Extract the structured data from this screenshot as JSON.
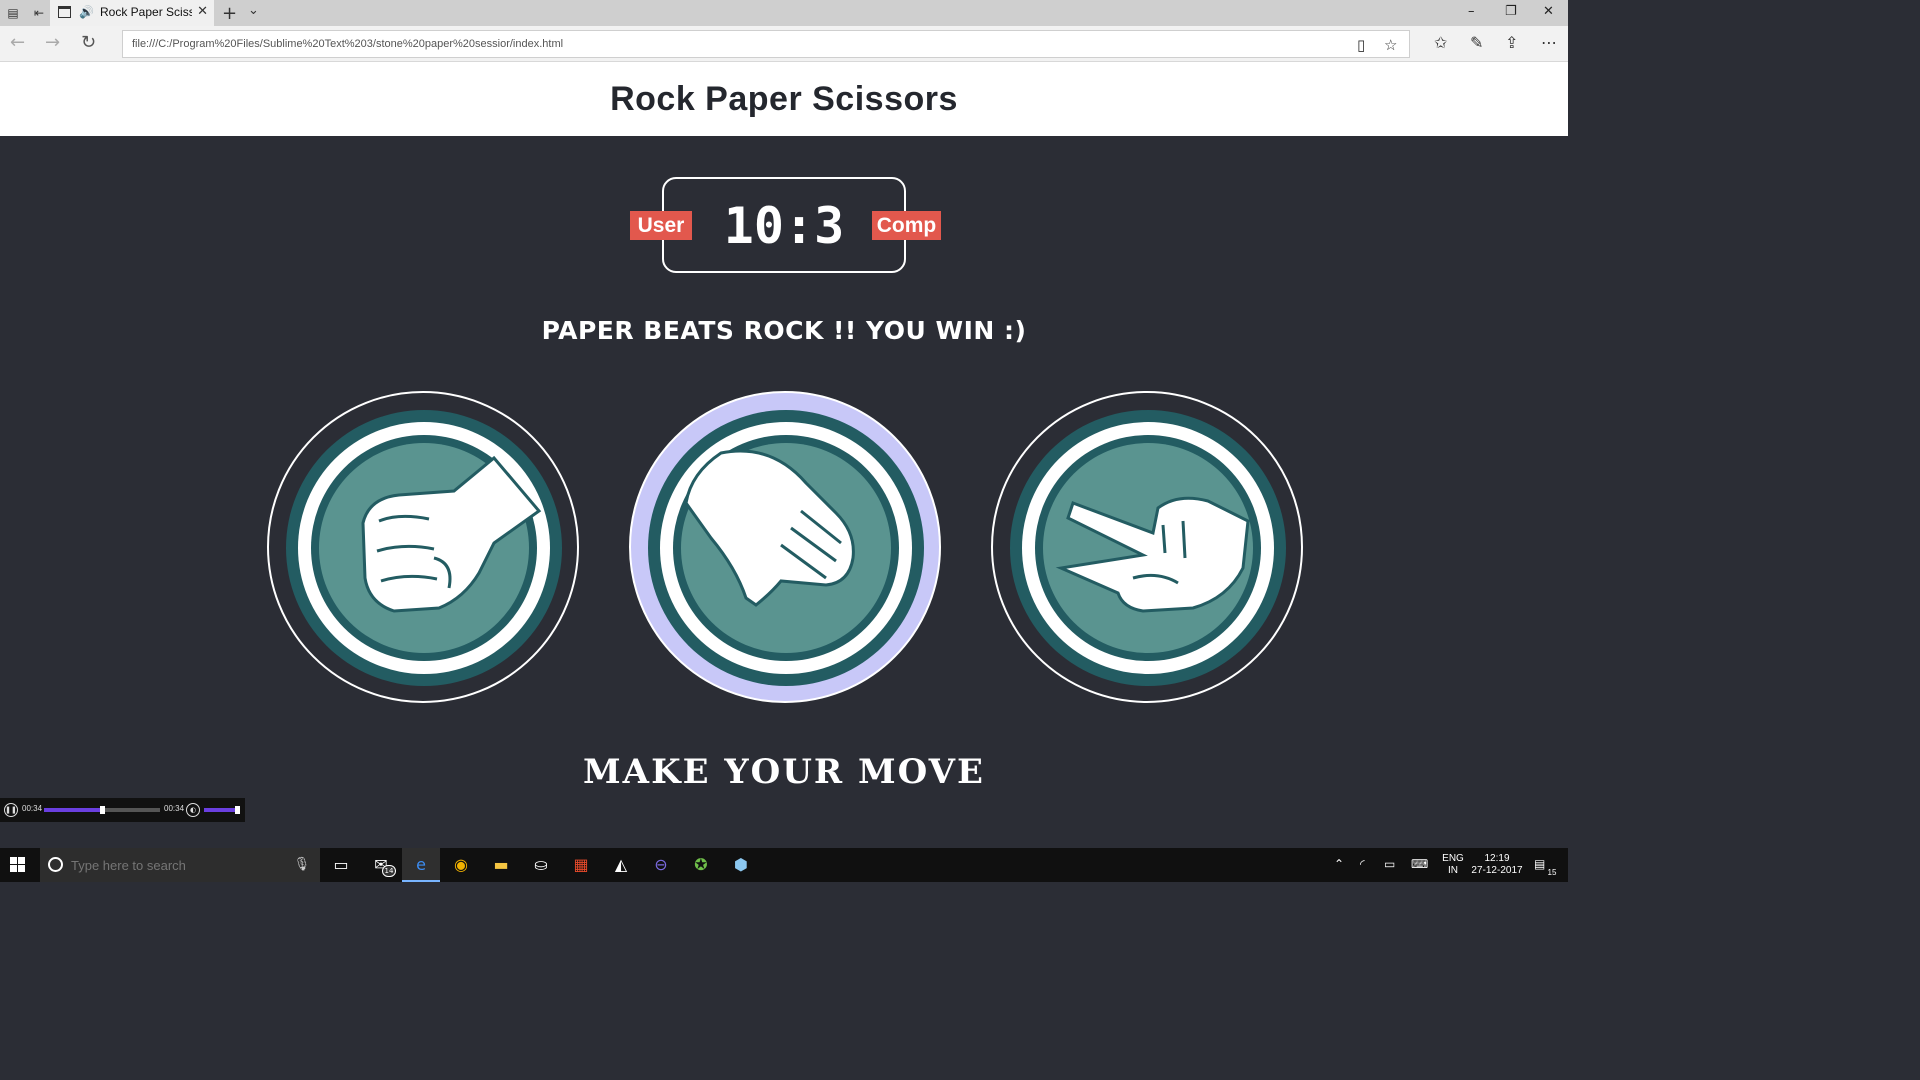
{
  "browser": {
    "tab_title": "Rock Paper Scissors",
    "address": "file:///C:/Program%20Files/Sublime%20Text%203/stone%20paper%20sessior/index.html"
  },
  "page": {
    "title": "Rock Paper Scissors",
    "user_label": "User",
    "comp_label": "Comp",
    "score": "10:3",
    "user_score": 10,
    "comp_score": 3,
    "result": "PAPER BEATS ROCK !! YOU WIN :)",
    "action": "MAKE YOUR MOVE",
    "choices": [
      "rock",
      "paper",
      "scissors"
    ],
    "selected_choice": "paper"
  },
  "colors": {
    "background": "#2b2d35",
    "badge": "#e2584d",
    "choice_inner": "#5a9490",
    "choice_ring": "#235c62",
    "selected_glow": "#c8c8f8"
  },
  "media": {
    "time_elapsed": "00:34",
    "time_total": "00:34",
    "progress": 0.5,
    "volume": 0.9
  },
  "taskbar": {
    "search_placeholder": "Type here to search",
    "mail_badge": "14",
    "lang_line1": "ENG",
    "lang_line2": "IN",
    "time": "12:19",
    "date": "27-12-2017",
    "notifications": "15"
  }
}
